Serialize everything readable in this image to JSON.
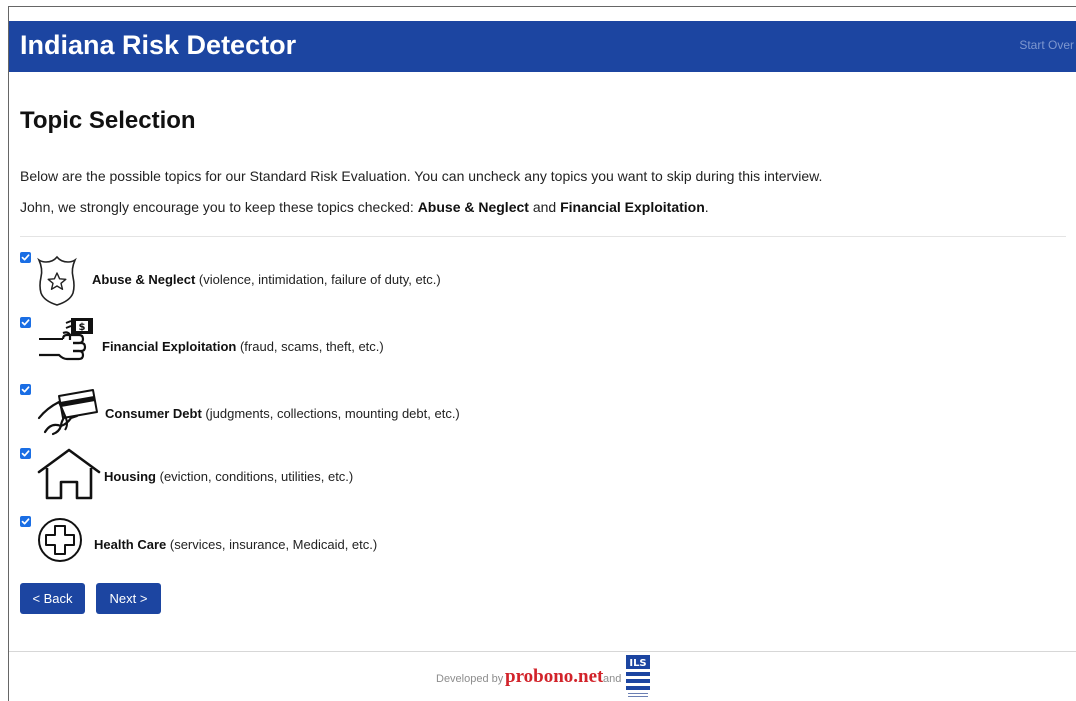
{
  "header": {
    "brand": "Indiana Risk Detector",
    "start_over": "Start Over"
  },
  "main": {
    "title": "Topic Selection",
    "intro_line_1": "Below are the possible topics for our Standard Risk Evaluation. You can uncheck any topics you want to skip during this interview.",
    "intro_line_2_prefix": "John, we strongly encourage you to keep these topics checked: ",
    "intro_line_2_topic_1": "Abuse & Neglect",
    "intro_line_2_and": " and ",
    "intro_line_2_topic_2": "Financial Exploitation",
    "intro_line_2_suffix": ".",
    "topics": [
      {
        "name": "Abuse & Neglect",
        "detail": " (violence, intimidation, failure of duty, etc.)",
        "checked": true,
        "icon": "police-badge-icon"
      },
      {
        "name": "Financial Exploitation",
        "detail": " (fraud, scams, theft, etc.)",
        "checked": true,
        "icon": "hand-money-icon"
      },
      {
        "name": "Consumer Debt",
        "detail": " (judgments, collections, mounting debt, etc.)",
        "checked": true,
        "icon": "credit-card-hand-icon"
      },
      {
        "name": "Housing",
        "detail": " (eviction, conditions, utilities, etc.)",
        "checked": true,
        "icon": "house-icon"
      },
      {
        "name": "Health Care",
        "detail": " (services, insurance, Medicaid, etc.)",
        "checked": true,
        "icon": "medical-cross-icon"
      }
    ],
    "back_label": "< Back",
    "next_label": "Next >"
  },
  "footer": {
    "developed_by": "Developed by",
    "probono": "probono.net",
    "and": "and",
    "ils_logo_text": "ILS",
    "ils_logo_subtext": "INDIANA LEGAL SERVICES"
  },
  "colors": {
    "brand_blue": "#1c45a1",
    "checkbox_blue": "#1a6ee4",
    "probono_red": "#d2232a"
  }
}
